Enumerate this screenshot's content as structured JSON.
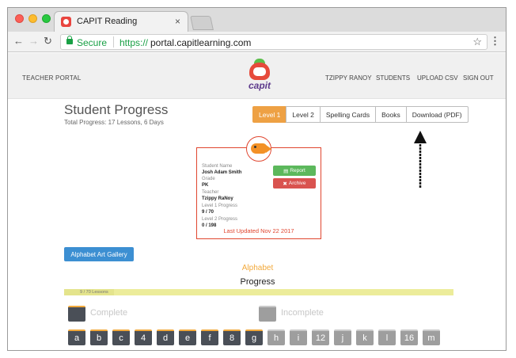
{
  "browser": {
    "tab_title": "CAPIT Reading",
    "tab_close": "×",
    "secure_label": "Secure",
    "url_protocol": "https://",
    "url_host": "portal.capitlearning.com"
  },
  "header": {
    "portal_label": "TEACHER PORTAL",
    "logo_text": "capit",
    "nav": [
      "TZIPPY RANOY",
      "STUDENTS",
      "UPLOAD CSV",
      "SIGN OUT"
    ]
  },
  "page": {
    "title": "Student Progress",
    "subtitle": "Total Progress: 17 Lessons, 6 Days"
  },
  "filter_buttons": [
    "Level 1",
    "Level 2",
    "Spelling Cards",
    "Books",
    "Download (PDF)"
  ],
  "student_card": {
    "name_label": "Student Name",
    "name": "Josh Adam Smith",
    "grade_label": "Grade",
    "grade": "PK",
    "teacher_label": "Teacher",
    "teacher": "Tzippy RaNoy",
    "level1_label": "Level 1 Progress",
    "level1": "9 / 70",
    "level2_label": "Level 2 Progress",
    "level2": "0 / 198",
    "report_label": "Report",
    "archive_label": "Archive",
    "updated": "Last Updated Nov 22 2017"
  },
  "gallery_label": "Alphabet Art Gallery",
  "alphabet": {
    "title": "Alphabet",
    "progress_title": "Progress",
    "progress_text": "9 / 70 Lessons",
    "progress_fraction": 0.1286
  },
  "legend": {
    "complete": "Complete",
    "incomplete": "Incomplete"
  },
  "lessons": [
    {
      "label": "a",
      "complete": true
    },
    {
      "label": "b",
      "complete": true
    },
    {
      "label": "c",
      "complete": true
    },
    {
      "label": "4",
      "complete": true
    },
    {
      "label": "d",
      "complete": true
    },
    {
      "label": "e",
      "complete": true
    },
    {
      "label": "f",
      "complete": true
    },
    {
      "label": "8",
      "complete": true
    },
    {
      "label": "g",
      "complete": true
    },
    {
      "label": "h",
      "complete": false
    },
    {
      "label": "i",
      "complete": false
    },
    {
      "label": "12",
      "complete": false
    },
    {
      "label": "j",
      "complete": false
    },
    {
      "label": "k",
      "complete": false
    },
    {
      "label": "l",
      "complete": false
    },
    {
      "label": "16",
      "complete": false
    },
    {
      "label": "m",
      "complete": false
    }
  ]
}
